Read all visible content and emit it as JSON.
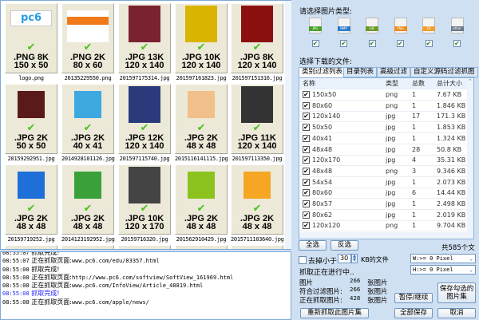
{
  "gallery": {
    "items": [
      {
        "info": ".PNG 8K",
        "size": "150 x 50",
        "file": "logo.png",
        "thumb": "pc6-logo",
        "c": "#2a9be0"
      },
      {
        "info": ".PNG 2K",
        "size": "80 x 60",
        "file": "20135229550.png",
        "thumb": "pps-tv-logo",
        "c": "#f07a1a"
      },
      {
        "info": ".JPG 13K",
        "size": "120 x 140",
        "file": "201597175314.jpg",
        "thumb": "game-cover",
        "c": "#7a2230"
      },
      {
        "info": ".JPG 10K",
        "size": "120 x 140",
        "file": "201597161823.jpg",
        "thumb": "metal-gear-cover",
        "c": "#d9b400"
      },
      {
        "info": ".JPG 8K",
        "size": "120 x 140",
        "file": "201597151316.jpg",
        "thumb": "game-cover",
        "c": "#8b1010"
      },
      {
        "info": ".JPG 2K",
        "size": "50 x 50",
        "file": "20159292951.jpg",
        "thumb": "game-icon",
        "c": "#5a1a1a"
      },
      {
        "info": ".JPG 2K",
        "size": "40 x 41",
        "file": "2014928101126.jpg",
        "thumb": "twitter-icon",
        "c": "#3ea8e0"
      },
      {
        "info": ".JPG 12K",
        "size": "120 x 140",
        "file": "201597115740.jpg",
        "thumb": "game-cover",
        "c": "#2a3a7a"
      },
      {
        "info": ".JPG 2K",
        "size": "48 x 48",
        "file": "2015116141115.jpg",
        "thumb": "anime-avatar",
        "c": "#f2c08a"
      },
      {
        "info": ".JPG 11K",
        "size": "120 x 140",
        "file": "201597113350.jpg",
        "thumb": "gta-cover",
        "c": "#333333"
      },
      {
        "info": ".JPG 2K",
        "size": "48 x 48",
        "file": "20159719252.jpg",
        "thumb": "blue-v-icon",
        "c": "#1e6fd8"
      },
      {
        "info": ".JPG 2K",
        "size": "48 x 48",
        "file": "2014123192952.jpg",
        "thumb": "cleaner-icon",
        "c": "#3aa03a"
      },
      {
        "info": ".JPG 10K",
        "size": "120 x 170",
        "file": "20159716320.jpg",
        "thumb": "metal-gear-cover",
        "c": "#444444"
      },
      {
        "info": ".JPG 2K",
        "size": "48 x 48",
        "file": "201562910429.jpg",
        "thumb": "feather-icon",
        "c": "#8cc21e"
      },
      {
        "info": ".JPG 2K",
        "size": "48 x 48",
        "file": "2015711103640.jpg",
        "thumb": "cloud-icon",
        "c": "#f5a623"
      }
    ]
  },
  "log": [
    {
      "time": "08:55:07",
      "msg": "抓取完成!",
      "url": "",
      "color": "#000000"
    },
    {
      "time": "08:55:07",
      "msg": "正在抓取页面:",
      "url": "www.pc6.com/edu/83357.html",
      "color": "#000000"
    },
    {
      "time": "08:55:08",
      "msg": "抓取完成!",
      "url": "",
      "color": "#000000"
    },
    {
      "time": "08:55:08",
      "msg": "正在抓取页面:",
      "url": "http://www.pc6.com/softview/SoftView_161969.html",
      "color": "#000000"
    },
    {
      "time": "08:55:08",
      "msg": "正在抓取页面:",
      "url": "www.pc6.com/InfoView/Article_48819.html",
      "color": "#000000"
    },
    {
      "time": "08:55:08",
      "msg": "抓取完成!",
      "url": "",
      "color": "#2222ff"
    },
    {
      "time": "08:55:08",
      "msg": "正在抓取页面:",
      "url": "www.pc6.com/apple/news/",
      "color": "#000000"
    }
  ],
  "right": {
    "type_label": "请选择图片类型:",
    "types": [
      {
        "name": "JPG",
        "c": "#4aa02a"
      },
      {
        "name": "BMP",
        "c": "#2a7ac8"
      },
      {
        "name": "GIF",
        "c": "#6a9a2a"
      },
      {
        "name": "PNG",
        "c": "#f08a1a"
      },
      {
        "name": "TIF",
        "c": "#f0a030"
      },
      {
        "name": "other",
        "c": "#6a7a8a"
      }
    ],
    "files_label": "选择下载的文件:",
    "tabs": [
      "类别过滤列表",
      "目录列表",
      "高级过滤",
      "自定义源码过滤抓图"
    ],
    "columns": [
      "名称",
      "类型",
      "总数",
      "总计大小"
    ],
    "rows": [
      [
        "150x50",
        "png",
        "1",
        "7.67 KB"
      ],
      [
        "80x60",
        "png",
        "1",
        "1.846 KB"
      ],
      [
        "120x140",
        "jpg",
        "17",
        "171.3 KB"
      ],
      [
        "50x50",
        "jpg",
        "1",
        "1.853 KB"
      ],
      [
        "40x41",
        "jpg",
        "1",
        "1.324 KB"
      ],
      [
        "48x48",
        "jpg",
        "28",
        "50.8 KB"
      ],
      [
        "120x170",
        "jpg",
        "4",
        "35.31 KB"
      ],
      [
        "48x48",
        "png",
        "3",
        "9.346 KB"
      ],
      [
        "54x54",
        "jpg",
        "1",
        "2.073 KB"
      ],
      [
        "80x60",
        "jpg",
        "6",
        "14.44 KB"
      ],
      [
        "80x57",
        "jpg",
        "1",
        "2.498 KB"
      ],
      [
        "80x62",
        "jpg",
        "1",
        "2.019 KB"
      ],
      [
        "120x120",
        "png",
        "1",
        "9.704 KB"
      ]
    ],
    "select_all": "全选",
    "invert": "反选",
    "total": "共585个文件",
    "filter_prefix": "去掉小于",
    "filter_value": "30",
    "filter_suffix": "KB的文件",
    "width_filter": "W:>= 0 Pixel",
    "height_filter": "H:>= 0 Pixel",
    "status": "抓取正在进行中..",
    "stats": [
      {
        "label": "图片",
        "value": "266",
        "unit": "张图片"
      },
      {
        "label": "符合过滤图片:",
        "value": "266",
        "unit": "张图片"
      },
      {
        "label": "正在抓取图片:",
        "value": "428",
        "unit": "张图片"
      }
    ],
    "pause": "暂停/继续",
    "save_checked": "保存勾选的图片集",
    "refetch": "重新抓取此图片集",
    "save_all": "全部保存",
    "cancel": "取消"
  }
}
